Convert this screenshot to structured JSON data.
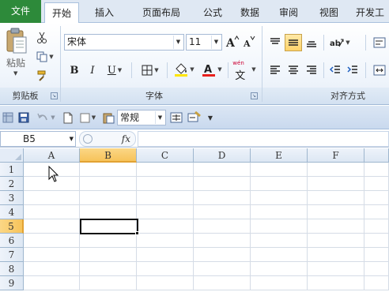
{
  "tabs": [
    {
      "label": "文件",
      "kind": "file"
    },
    {
      "label": "开始",
      "kind": "active"
    },
    {
      "label": "插入",
      "kind": "normal"
    },
    {
      "label": "页面布局",
      "kind": "normal"
    },
    {
      "label": "公式",
      "kind": "normal"
    },
    {
      "label": "数据",
      "kind": "normal"
    },
    {
      "label": "审阅",
      "kind": "normal"
    },
    {
      "label": "视图",
      "kind": "normal"
    },
    {
      "label": "开发工",
      "kind": "normal"
    }
  ],
  "ribbon": {
    "clipboard": {
      "paste_label": "粘贴",
      "caption": "剪贴板"
    },
    "font": {
      "name": "宋体",
      "size": "11",
      "caption": "字体",
      "bold": "B",
      "italic": "I",
      "underline": "U",
      "font_color_letter": "A",
      "phonetic_label": "wén",
      "phonetic_char": "文"
    },
    "alignment": {
      "caption": "对齐方式"
    }
  },
  "qat": {
    "number_format": "常规"
  },
  "formula_bar": {
    "name_box": "B5",
    "fx_label": "fx",
    "formula_value": ""
  },
  "grid": {
    "columns": [
      "A",
      "B",
      "C",
      "D",
      "E",
      "F"
    ],
    "rows": [
      "1",
      "2",
      "3",
      "4",
      "5",
      "6",
      "7",
      "8",
      "9"
    ],
    "selected_column": "B",
    "selected_row": "5"
  },
  "colors": {
    "file_tab": "#2d8a3a",
    "selection_header": "#f7c35a",
    "font_color_bar": "#e8201c",
    "fill_color_bar": "#ffe500",
    "active_align": "#ffd36b"
  }
}
